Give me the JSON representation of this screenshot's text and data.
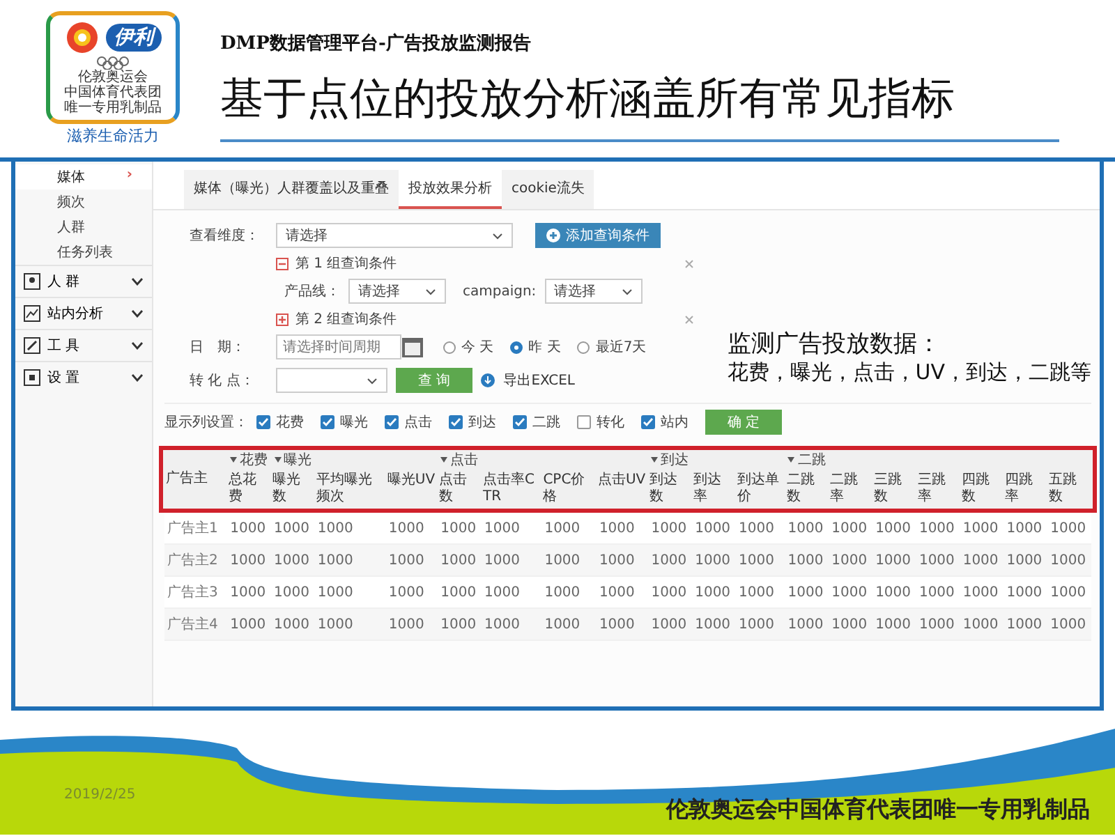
{
  "header": {
    "subtitle": "DMP数据管理平台-广告投放监测报告",
    "title": "基于点位的投放分析涵盖所有常见指标"
  },
  "logo": {
    "brand": "伊利",
    "line_1": "伦敦奥运会",
    "line_2": "中国体育代表团",
    "line_3": "唯一专用乳制品",
    "slogan": "滋养生命活力"
  },
  "sidebar": {
    "sub_items": [
      {
        "label": "媒体",
        "selected": true,
        "arrow": "›"
      },
      {
        "label": "频次",
        "selected": false
      },
      {
        "label": "人群",
        "selected": false
      },
      {
        "label": "任务列表",
        "selected": false
      }
    ],
    "sections": [
      {
        "label": "人 群"
      },
      {
        "label": "站内分析"
      },
      {
        "label": "工 具"
      },
      {
        "label": "设 置"
      }
    ]
  },
  "tabs": [
    {
      "label": "媒体（曝光）人群覆盖以及重叠",
      "selected": false
    },
    {
      "label": "投放效果分析",
      "selected": true
    },
    {
      "label": "cookie流失",
      "selected": false
    }
  ],
  "form": {
    "dimension": {
      "label": "查看维度：",
      "value": "请选择"
    },
    "add_button": "添加查询条件",
    "groups": [
      {
        "title": "第 1 组查询条件",
        "expanded": true,
        "fields": [
          {
            "label": "产品线：",
            "value": "请选择"
          },
          {
            "label": "campaign:",
            "value": "请选择"
          }
        ]
      },
      {
        "title": "第 2 组查询条件",
        "expanded": false
      }
    ],
    "date": {
      "label": "日　期：",
      "placeholder": "请选择时间周期",
      "options": [
        {
          "label": "今 天",
          "selected": false
        },
        {
          "label": "昨 天",
          "selected": true
        },
        {
          "label": "最近7天",
          "selected": false
        }
      ]
    },
    "conversion": {
      "label": "转 化 点："
    },
    "query_button": "查 询",
    "export_link": "导出EXCEL",
    "columns_setting": {
      "label": "显示列设置：",
      "options": [
        {
          "label": "花费",
          "checked": true
        },
        {
          "label": "曝光",
          "checked": true
        },
        {
          "label": "点击",
          "checked": true
        },
        {
          "label": "到达",
          "checked": true
        },
        {
          "label": "二跳",
          "checked": true
        },
        {
          "label": "转化",
          "checked": false
        },
        {
          "label": "站内",
          "checked": true
        }
      ],
      "confirm_button": "确 定"
    }
  },
  "annotation": {
    "line_1": "监测广告投放数据：",
    "line_2": "花费，曝光，点击，UV，到达，二跳等"
  },
  "table": {
    "row_header": "广告主",
    "columns": [
      {
        "label": "总花费",
        "group": "花费"
      },
      {
        "label": "曝光数",
        "group": "曝光"
      },
      {
        "label": "平均曝光频次"
      },
      {
        "label": "曝光UV"
      },
      {
        "label": "点击数",
        "group": "点击"
      },
      {
        "label": "点击率CTR"
      },
      {
        "label": "CPC价格"
      },
      {
        "label": "点击UV"
      },
      {
        "label": "到达数",
        "group": "到达"
      },
      {
        "label": "到达率"
      },
      {
        "label": "到达单价"
      },
      {
        "label": "二跳数",
        "group": "二跳"
      },
      {
        "label": "二跳率"
      },
      {
        "label": "三跳数"
      },
      {
        "label": "三跳率"
      },
      {
        "label": "四跳数"
      },
      {
        "label": "四跳率"
      },
      {
        "label": "五跳数"
      }
    ],
    "rows": [
      {
        "name": "广告主1",
        "cells": [
          "1000",
          "1000",
          "1000",
          "1000",
          "1000",
          "1000",
          "1000",
          "1000",
          "1000",
          "1000",
          "1000",
          "1000",
          "1000",
          "1000",
          "1000",
          "1000",
          "1000",
          "1000"
        ]
      },
      {
        "name": "广告主2",
        "cells": [
          "1000",
          "1000",
          "1000",
          "1000",
          "1000",
          "1000",
          "1000",
          "1000",
          "1000",
          "1000",
          "1000",
          "1000",
          "1000",
          "1000",
          "1000",
          "1000",
          "1000",
          "1000"
        ]
      },
      {
        "name": "广告主3",
        "cells": [
          "1000",
          "1000",
          "1000",
          "1000",
          "1000",
          "1000",
          "1000",
          "1000",
          "1000",
          "1000",
          "1000",
          "1000",
          "1000",
          "1000",
          "1000",
          "1000",
          "1000",
          "1000"
        ]
      },
      {
        "name": "广告主4",
        "cells": [
          "1000",
          "1000",
          "1000",
          "1000",
          "1000",
          "1000",
          "1000",
          "1000",
          "1000",
          "1000",
          "1000",
          "1000",
          "1000",
          "1000",
          "1000",
          "1000",
          "1000",
          "1000"
        ]
      }
    ]
  },
  "footer": {
    "date": "2019/2/25",
    "slogan": "伦敦奥运会中国体育代表团唯一专用乳制品"
  }
}
